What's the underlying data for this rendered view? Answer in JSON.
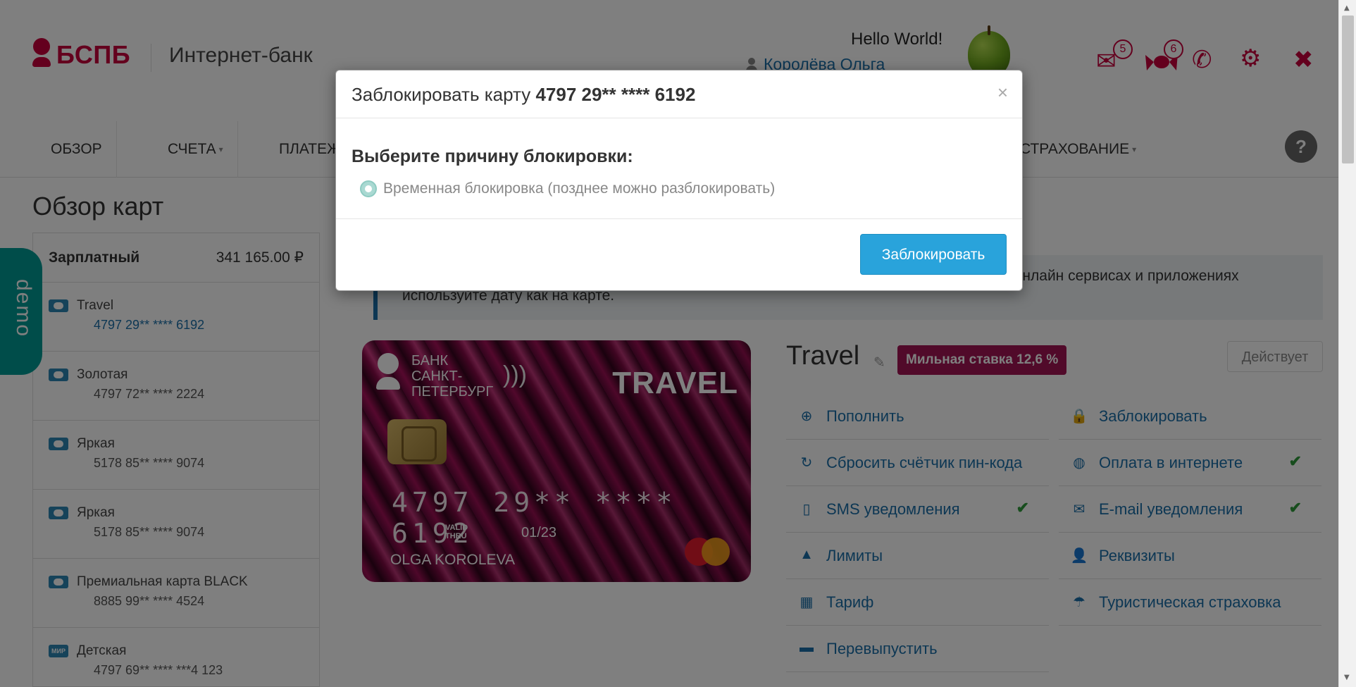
{
  "header": {
    "logo_text": "БСПБ",
    "subtitle": "Интернет-банк",
    "greeting": "Hello World!",
    "user_name": "Королёва Ольга",
    "mail_count": "5",
    "gift_count": "6"
  },
  "nav": {
    "items": [
      {
        "label": "ОБЗОР"
      },
      {
        "label": "СЧЕТА"
      },
      {
        "label": "ПЛАТЕЖИ"
      },
      {
        "label": "СТРАХОВАНИЕ"
      }
    ],
    "help": "?"
  },
  "page": {
    "title": "Обзор карт",
    "demo_label": "demo"
  },
  "sidebar": {
    "group_name": "Зарплатный",
    "group_sum": "341 165.00 ₽",
    "cards": [
      {
        "title": "Travel",
        "number": "4797 29** **** 6192",
        "icon": "card-icon"
      },
      {
        "title": "Золотая",
        "number": "4797 72** **** 2224",
        "icon": "card-icon"
      },
      {
        "title": "Яркая",
        "number": "5178 85** **** 9074",
        "icon": "card-icon"
      },
      {
        "title": "Яркая",
        "number": "5178 85** **** 9074",
        "icon": "card-icon"
      },
      {
        "title": "Премиальная карта BLACK",
        "number": "8885 99** **** 4524",
        "icon": "card-icon"
      },
      {
        "title": "Детская",
        "number": "4797 69** **** ***4 123",
        "icon": "mir-icon",
        "icon_text": "МИР"
      }
    ]
  },
  "notice": {
    "line1": "ки в онлайн сервисах и приложениях",
    "line2": "используйте дату как на карте."
  },
  "card_image": {
    "bank_line1": "БАНК",
    "bank_line2": "САНКТ-",
    "bank_line3": "ПЕТЕРБУРГ",
    "brand": "TRAVEL",
    "pan": "4797 29** **** 6192",
    "valid_line1": "VALID",
    "valid_line2": "THRU",
    "expiry": "01/23",
    "holder": "OLGA KOROLEVA"
  },
  "card_detail": {
    "title": "Travel",
    "rate_badge": "Мильная ставка 12,6 %",
    "status": "Действует"
  },
  "actions": [
    {
      "label": "Пополнить",
      "icon": "plus-circle-icon",
      "glyph": "⊕",
      "checked": false
    },
    {
      "label": "Заблокировать",
      "icon": "lock-icon",
      "glyph": "🔒",
      "checked": false
    },
    {
      "label": "Сбросить счётчик пин-кода",
      "icon": "refresh-icon",
      "glyph": "↻",
      "checked": false
    },
    {
      "label": "Оплата в интернете",
      "icon": "globe-icon",
      "glyph": "◍",
      "checked": true
    },
    {
      "label": "SMS уведомления",
      "icon": "phone-icon",
      "glyph": "▯",
      "checked": true
    },
    {
      "label": "E-mail уведомления",
      "icon": "envelope-icon",
      "glyph": "✉",
      "checked": true
    },
    {
      "label": "Лимиты",
      "icon": "warning-icon",
      "glyph": "▲",
      "checked": false
    },
    {
      "label": "Реквизиты",
      "icon": "user-icon",
      "glyph": "👤",
      "checked": false
    },
    {
      "label": "Тариф",
      "icon": "calculator-icon",
      "glyph": "▦",
      "checked": false
    },
    {
      "label": "Туристическая страховка",
      "icon": "umbrella-icon",
      "glyph": "☂",
      "checked": false
    },
    {
      "label": "Перевыпустить",
      "icon": "card-reissue-icon",
      "glyph": "▬",
      "checked": false
    }
  ],
  "check_glyph": "✔",
  "modal": {
    "title_prefix": "Заблокировать карту ",
    "title_card": "4797 29** **** 6192",
    "close": "×",
    "question": "Выберите причину блокировки:",
    "option": "Временная блокировка (позднее можно разблокировать)",
    "submit": "Заблокировать"
  },
  "colors": {
    "brand": "#c8003c",
    "link": "#1a6fa8",
    "primary_button": "#29a3db",
    "rate_badge": "#a31555",
    "check": "#2e9a3a"
  }
}
